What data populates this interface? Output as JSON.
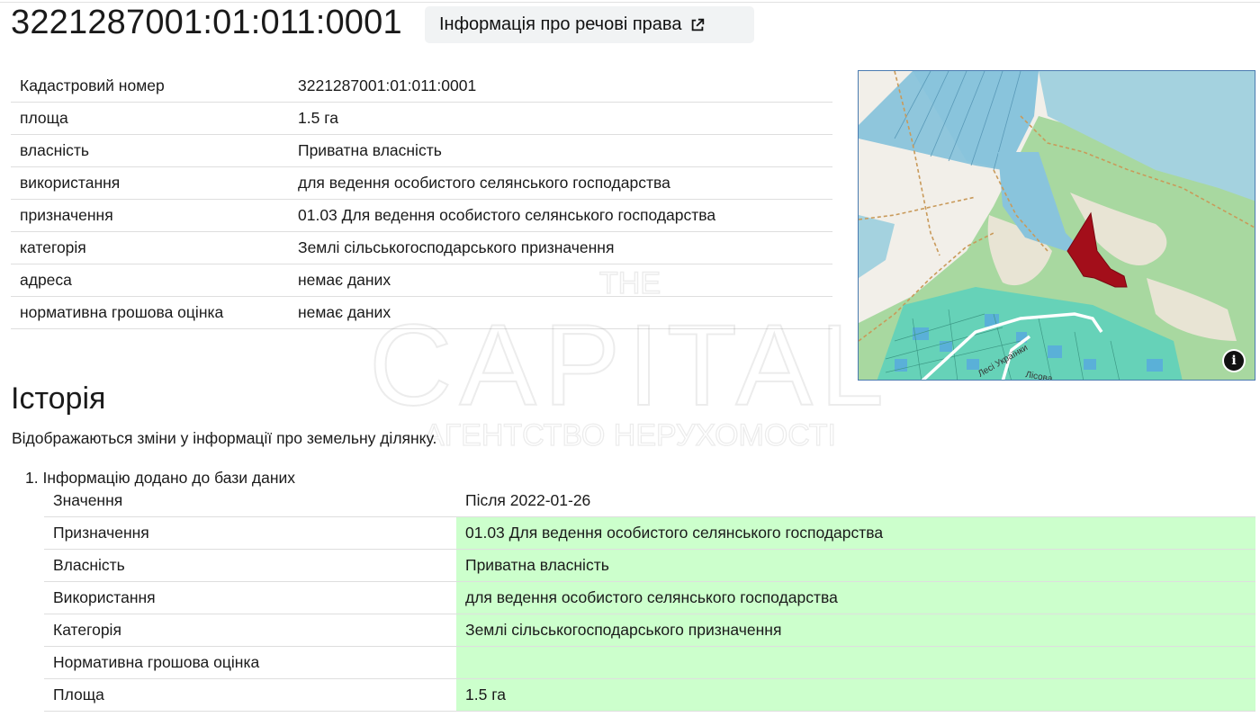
{
  "header": {
    "title": "3221287001:01:011:0001",
    "rights_button_label": "Інформація про речові права"
  },
  "info": {
    "rows": [
      {
        "key": "Кадастровий номер",
        "value": "3221287001:01:011:0001"
      },
      {
        "key": "площа",
        "value": "1.5 га"
      },
      {
        "key": "власність",
        "value": "Приватна власність"
      },
      {
        "key": "використання",
        "value": "для ведення особистого селянського господарства"
      },
      {
        "key": "призначення",
        "value": "01.03 Для ведення особистого селянського господарства"
      },
      {
        "key": "категорія",
        "value": "Землі сільськогосподарського призначення"
      },
      {
        "key": "адреса",
        "value": "немає даних"
      },
      {
        "key": "нормативна грошова оцінка",
        "value": "немає даних"
      }
    ]
  },
  "map": {
    "street_labels": [
      "Лесі Українки",
      "Лісова"
    ],
    "info_glyph": "i",
    "colors": {
      "forest": "#a8d8a0",
      "water": "#a4d2df",
      "parcel_blue": "#89c4dc",
      "parcel_teal": "#66d2b8",
      "highlight": "#a30e1a",
      "road_path": "#c99a5a"
    }
  },
  "history": {
    "title": "Історія",
    "description": "Відображаються зміни у інформації про земельну ділянку.",
    "items": [
      {
        "title": "1. Інформацію додано до бази даних",
        "header": {
          "key": "Значення",
          "value": "Після 2022-01-26"
        },
        "rows": [
          {
            "key": "Призначення",
            "value": "01.03 Для ведення особистого селянського господарства"
          },
          {
            "key": "Власність",
            "value": "Приватна власність"
          },
          {
            "key": "Використання",
            "value": "для ведення особистого селянського господарства"
          },
          {
            "key": "Категорія",
            "value": "Землі сільськогосподарського призначення"
          },
          {
            "key": "Нормативна грошова оцінка",
            "value": ""
          },
          {
            "key": "Площа",
            "value": "1.5 га"
          }
        ]
      }
    ]
  },
  "watermark": {
    "line1": "THE",
    "line2": "CAPITAL",
    "line3": "АГЕНТСТВО НЕРУХОМОСТІ"
  },
  "colors": {
    "added_bg": "#ccffcc",
    "row_border": "#dedede",
    "button_bg": "#f1f3f4"
  }
}
